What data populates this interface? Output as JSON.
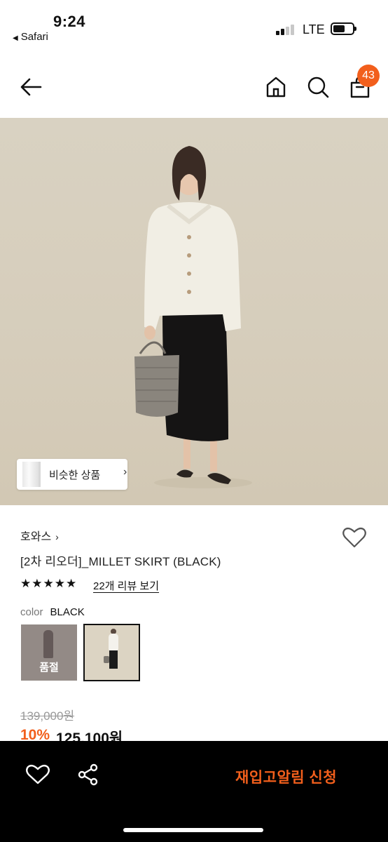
{
  "status_bar": {
    "time": "9:24",
    "back_app": "Safari",
    "network": "LTE"
  },
  "header": {
    "back_icon": "arrow-left-icon",
    "home_icon": "home-icon",
    "search_icon": "search-icon",
    "cart_icon": "shopping-bag-icon",
    "cart_count": "43",
    "accent_color": "#f25f1c"
  },
  "hero": {
    "similar_button_label": "비슷한 상품",
    "similar_button_chevron": "›"
  },
  "product": {
    "brand": "호와스",
    "brand_chevron": "›",
    "title": "[2차 리오더]_MILLET SKIRT (BLACK)",
    "rating": 5,
    "stars": "★★★★★",
    "review_link": "22개 리뷰 보기",
    "color_label": "color",
    "color_value": "BLACK",
    "swatches": [
      {
        "state": "sold-out",
        "label": "품절"
      },
      {
        "state": "selected",
        "label": ""
      }
    ],
    "original_price": "139,000원",
    "discount": "10%",
    "sale_price": "125,100원"
  },
  "bottom_bar": {
    "wishlist_icon": "heart-icon",
    "share_icon": "share-icon",
    "restock_button": "재입고알림 신청"
  }
}
